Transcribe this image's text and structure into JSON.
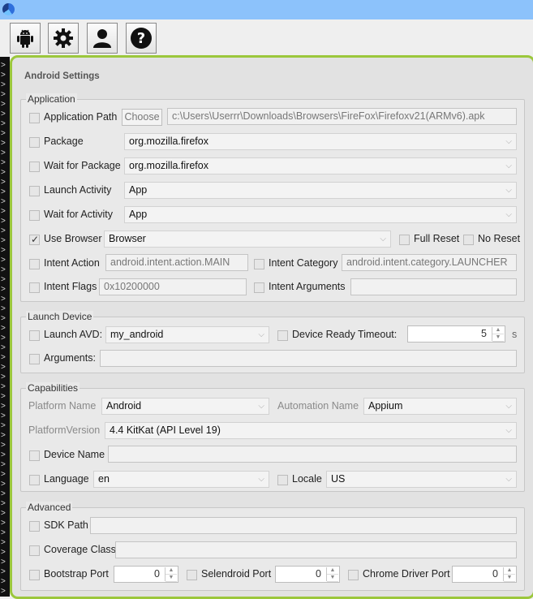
{
  "toolbar": {
    "buttons": [
      {
        "icon": "android-icon"
      },
      {
        "icon": "gear-icon"
      },
      {
        "icon": "user-icon"
      },
      {
        "icon": "help-icon"
      }
    ]
  },
  "sidebar_arrow": ">",
  "heading": "Android Settings",
  "application": {
    "legend": "Application",
    "app_path_label": "Application Path",
    "choose_label": "Choose",
    "app_path_value": "c:\\Users\\Userrr\\Downloads\\Browsers\\FireFox\\Firefoxv21(ARMv6).apk",
    "package_label": "Package",
    "package_value": "org.mozilla.firefox",
    "wait_package_label": "Wait for Package",
    "wait_package_value": "org.mozilla.firefox",
    "launch_activity_label": "Launch Activity",
    "launch_activity_value": "App",
    "wait_activity_label": "Wait for Activity",
    "wait_activity_value": "App",
    "use_browser_label": "Use Browser",
    "use_browser_checked": true,
    "browser_value": "Browser",
    "full_reset_label": "Full Reset",
    "no_reset_label": "No Reset",
    "intent_action_label": "Intent Action",
    "intent_action_value": "android.intent.action.MAIN",
    "intent_category_label": "Intent Category",
    "intent_category_value": "android.intent.category.LAUNCHER",
    "intent_flags_label": "Intent Flags",
    "intent_flags_value": "0x10200000",
    "intent_args_label": "Intent Arguments",
    "intent_args_value": ""
  },
  "launch_device": {
    "legend": "Launch Device",
    "launch_avd_label": "Launch AVD:",
    "launch_avd_value": "my_android",
    "ready_timeout_label": "Device Ready Timeout:",
    "ready_timeout_value": "5",
    "ready_timeout_unit": "s",
    "arguments_label": "Arguments:",
    "arguments_value": ""
  },
  "capabilities": {
    "legend": "Capabilities",
    "platform_name_label": "Platform Name",
    "platform_name_value": "Android",
    "automation_name_label": "Automation Name",
    "automation_name_value": "Appium",
    "platform_version_label": "PlatformVersion",
    "platform_version_value": "4.4 KitKat (API Level 19)",
    "device_name_label": "Device Name",
    "device_name_value": "",
    "language_label": "Language",
    "language_value": "en",
    "locale_label": "Locale",
    "locale_value": "US"
  },
  "advanced": {
    "legend": "Advanced",
    "sdk_path_label": "SDK Path",
    "sdk_path_value": "",
    "coverage_class_label": "Coverage Class",
    "coverage_class_value": "",
    "bootstrap_port_label": "Bootstrap Port",
    "bootstrap_port_value": "0",
    "selendroid_port_label": "Selendroid Port",
    "selendroid_port_value": "0",
    "chrome_driver_port_label": "Chrome Driver Port",
    "chrome_driver_port_value": "0"
  },
  "colors": {
    "titlebar": "#8cc2fb",
    "panel_border": "#9bc73c"
  }
}
